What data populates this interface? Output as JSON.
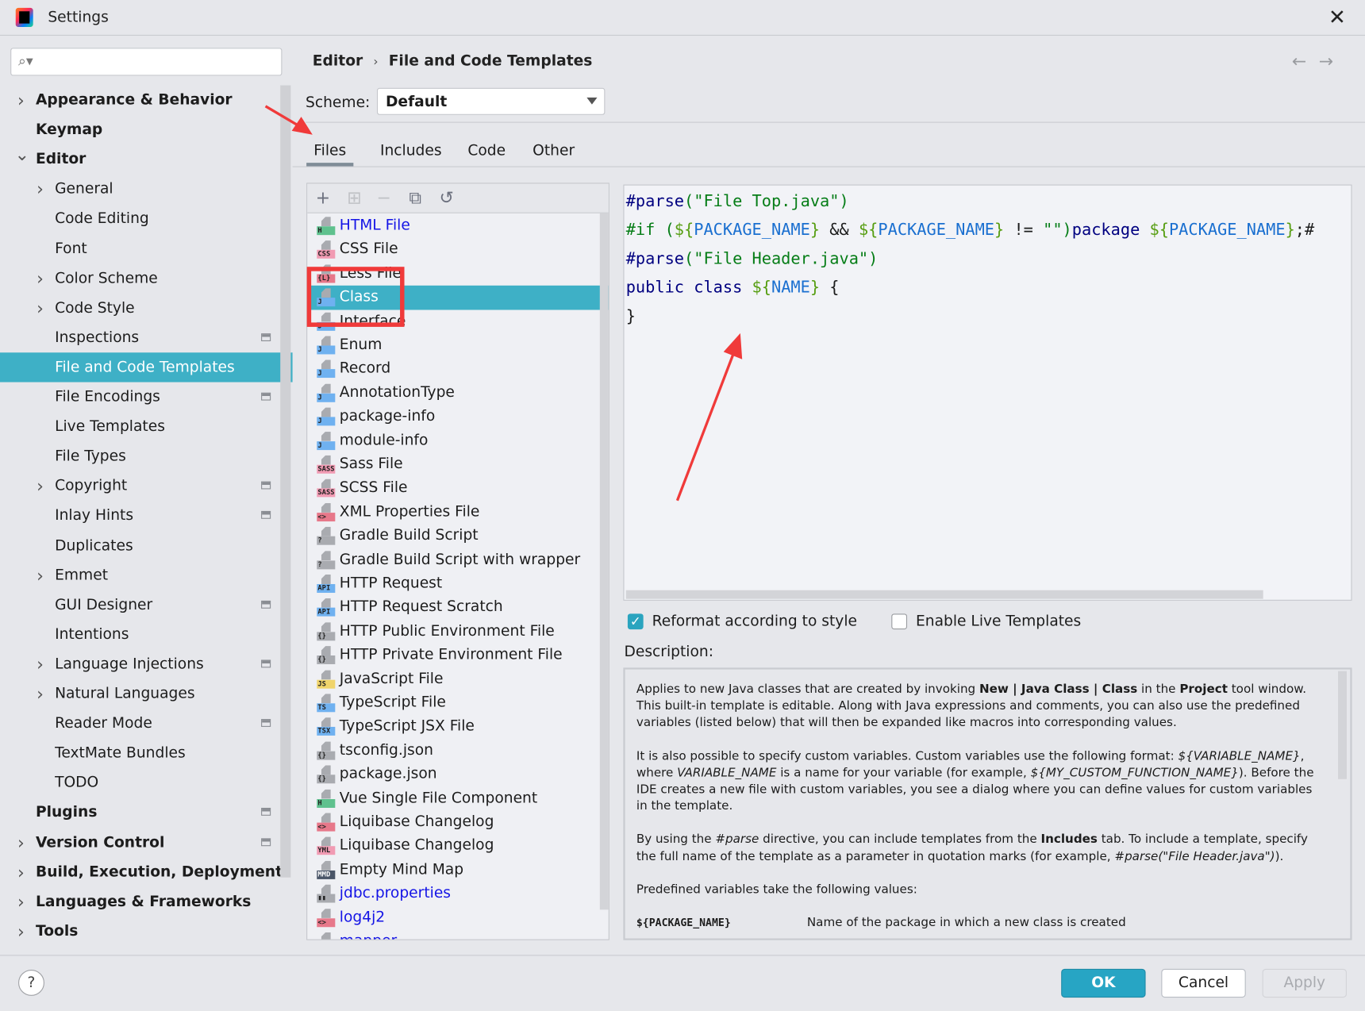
{
  "window": {
    "title": "Settings",
    "close_icon": "close-icon"
  },
  "search": {
    "placeholder": "",
    "icon": "search-icon"
  },
  "sidebar": {
    "selected": "File and Code Templates",
    "items": [
      {
        "label": "Appearance & Behavior",
        "level": 0,
        "bold": true,
        "arrow": "right",
        "project_icon": false
      },
      {
        "label": "Keymap",
        "level": 0,
        "bold": true,
        "arrow": "none",
        "project_icon": false
      },
      {
        "label": "Editor",
        "level": 0,
        "bold": true,
        "arrow": "down",
        "project_icon": false
      },
      {
        "label": "General",
        "level": 1,
        "bold": false,
        "arrow": "right",
        "project_icon": false
      },
      {
        "label": "Code Editing",
        "level": 1,
        "bold": false,
        "arrow": "none",
        "project_icon": false
      },
      {
        "label": "Font",
        "level": 1,
        "bold": false,
        "arrow": "none",
        "project_icon": false
      },
      {
        "label": "Color Scheme",
        "level": 1,
        "bold": false,
        "arrow": "right",
        "project_icon": false
      },
      {
        "label": "Code Style",
        "level": 1,
        "bold": false,
        "arrow": "right",
        "project_icon": false
      },
      {
        "label": "Inspections",
        "level": 1,
        "bold": false,
        "arrow": "none",
        "project_icon": true
      },
      {
        "label": "File and Code Templates",
        "level": 1,
        "bold": false,
        "arrow": "none",
        "project_icon": false,
        "selected": true
      },
      {
        "label": "File Encodings",
        "level": 1,
        "bold": false,
        "arrow": "none",
        "project_icon": true
      },
      {
        "label": "Live Templates",
        "level": 1,
        "bold": false,
        "arrow": "none",
        "project_icon": false
      },
      {
        "label": "File Types",
        "level": 1,
        "bold": false,
        "arrow": "none",
        "project_icon": false
      },
      {
        "label": "Copyright",
        "level": 1,
        "bold": false,
        "arrow": "right",
        "project_icon": true
      },
      {
        "label": "Inlay Hints",
        "level": 1,
        "bold": false,
        "arrow": "none",
        "project_icon": true
      },
      {
        "label": "Duplicates",
        "level": 1,
        "bold": false,
        "arrow": "none",
        "project_icon": false
      },
      {
        "label": "Emmet",
        "level": 1,
        "bold": false,
        "arrow": "right",
        "project_icon": false
      },
      {
        "label": "GUI Designer",
        "level": 1,
        "bold": false,
        "arrow": "none",
        "project_icon": true
      },
      {
        "label": "Intentions",
        "level": 1,
        "bold": false,
        "arrow": "none",
        "project_icon": false
      },
      {
        "label": "Language Injections",
        "level": 1,
        "bold": false,
        "arrow": "right",
        "project_icon": true
      },
      {
        "label": "Natural Languages",
        "level": 1,
        "bold": false,
        "arrow": "right",
        "project_icon": false
      },
      {
        "label": "Reader Mode",
        "level": 1,
        "bold": false,
        "arrow": "none",
        "project_icon": true
      },
      {
        "label": "TextMate Bundles",
        "level": 1,
        "bold": false,
        "arrow": "none",
        "project_icon": false
      },
      {
        "label": "TODO",
        "level": 1,
        "bold": false,
        "arrow": "none",
        "project_icon": false
      },
      {
        "label": "Plugins",
        "level": 0,
        "bold": true,
        "arrow": "none",
        "project_icon": true
      },
      {
        "label": "Version Control",
        "level": 0,
        "bold": true,
        "arrow": "right",
        "project_icon": true
      },
      {
        "label": "Build, Execution, Deployment",
        "level": 0,
        "bold": true,
        "arrow": "right",
        "project_icon": false
      },
      {
        "label": "Languages & Frameworks",
        "level": 0,
        "bold": true,
        "arrow": "right",
        "project_icon": false
      },
      {
        "label": "Tools",
        "level": 0,
        "bold": true,
        "arrow": "right",
        "project_icon": false
      }
    ]
  },
  "breadcrumb": {
    "parent": "Editor",
    "separator": "›",
    "current": "File and Code Templates"
  },
  "nav": {
    "back": "←",
    "forward": "→"
  },
  "scheme": {
    "label": "Scheme:",
    "value": "Default"
  },
  "tabs": [
    {
      "label": "Files",
      "active": true
    },
    {
      "label": "Includes"
    },
    {
      "label": "Code"
    },
    {
      "label": "Other"
    }
  ],
  "toolbar": {
    "add": "+",
    "add_child": "⊞",
    "remove": "−",
    "copy": "⧉",
    "reset": "↺"
  },
  "templates": {
    "selected": "Class",
    "items": [
      {
        "name": "HTML File",
        "badge": "H",
        "badge_color": "#5fc18e",
        "link": true
      },
      {
        "name": "CSS File",
        "badge": "CSS",
        "badge_color": "#f19bb3"
      },
      {
        "name": "Less File",
        "badge": "{L}",
        "badge_color": "#e7788a"
      },
      {
        "name": "Class",
        "badge": "J",
        "badge_color": "#6fb1f0",
        "selected": true
      },
      {
        "name": "Interface",
        "badge": "J",
        "badge_color": "#6fb1f0"
      },
      {
        "name": "Enum",
        "badge": "J",
        "badge_color": "#6fb1f0"
      },
      {
        "name": "Record",
        "badge": "J",
        "badge_color": "#6fb1f0"
      },
      {
        "name": "AnnotationType",
        "badge": "J",
        "badge_color": "#6fb1f0"
      },
      {
        "name": "package-info",
        "badge": "J",
        "badge_color": "#6fb1f0"
      },
      {
        "name": "module-info",
        "badge": "J",
        "badge_color": "#6fb1f0"
      },
      {
        "name": "Sass File",
        "badge": "SASS",
        "badge_color": "#f19bb3"
      },
      {
        "name": "SCSS File",
        "badge": "SASS",
        "badge_color": "#f19bb3"
      },
      {
        "name": "XML Properties File",
        "badge": "<>",
        "badge_color": "#e7788a"
      },
      {
        "name": "Gradle Build Script",
        "badge": "?",
        "badge_color": "#a9abb0"
      },
      {
        "name": "Gradle Build Script with wrapper",
        "badge": "?",
        "badge_color": "#a9abb0"
      },
      {
        "name": "HTTP Request",
        "badge": "API",
        "badge_color": "#6fb1f0"
      },
      {
        "name": "HTTP Request Scratch",
        "badge": "API",
        "badge_color": "#6fb1f0"
      },
      {
        "name": "HTTP Public Environment File",
        "badge": "{}",
        "badge_color": "#a9abb0"
      },
      {
        "name": "HTTP Private Environment File",
        "badge": "{}",
        "badge_color": "#a9abb0"
      },
      {
        "name": "JavaScript File",
        "badge": "JS",
        "badge_color": "#f0d46b"
      },
      {
        "name": "TypeScript File",
        "badge": "TS",
        "badge_color": "#6fb1f0"
      },
      {
        "name": "TypeScript JSX File",
        "badge": "TSX",
        "badge_color": "#6fb1f0"
      },
      {
        "name": "tsconfig.json",
        "badge": "{}",
        "badge_color": "#a9abb0"
      },
      {
        "name": "package.json",
        "badge": "{}",
        "badge_color": "#a9abb0"
      },
      {
        "name": "Vue Single File Component",
        "badge": "H",
        "badge_color": "#5fc18e"
      },
      {
        "name": "Liquibase Changelog",
        "badge": "<>",
        "badge_color": "#e7788a"
      },
      {
        "name": "Liquibase Changelog",
        "badge": "YML",
        "badge_color": "#f19bb3"
      },
      {
        "name": "Empty Mind Map",
        "badge": "MMD",
        "badge_color": "#4a5568"
      },
      {
        "name": "jdbc.properties",
        "badge": "▮▮",
        "badge_color": "#a9abb0",
        "link": true
      },
      {
        "name": "log4j2",
        "badge": "<>",
        "badge_color": "#e7788a",
        "link": true
      },
      {
        "name": "mapper",
        "badge": "",
        "badge_color": "#f19bb3",
        "link": true
      }
    ]
  },
  "editor": {
    "lines": [
      [
        [
          "#parse",
          "dir"
        ],
        [
          "(",
          "str"
        ],
        [
          "\"File Top.java\"",
          "str"
        ],
        [
          ")",
          "str"
        ]
      ],
      [
        [
          "#if",
          "str"
        ],
        [
          " (",
          "str"
        ],
        [
          "${",
          "dol"
        ],
        [
          "PACKAGE_NAME",
          "var"
        ],
        [
          "}",
          "dol"
        ],
        [
          " && ",
          "pl"
        ],
        [
          "${",
          "dol"
        ],
        [
          "PACKAGE_NAME",
          "var"
        ],
        [
          "}",
          "dol"
        ],
        [
          " != ",
          "pl"
        ],
        [
          "\"\"",
          "str"
        ],
        [
          ")",
          "str"
        ],
        [
          "package ",
          "kw"
        ],
        [
          "${",
          "dol"
        ],
        [
          "PACKAGE_NAME",
          "var"
        ],
        [
          "}",
          "dol"
        ],
        [
          ";#",
          "pl"
        ]
      ],
      [
        [
          "#parse",
          "dir"
        ],
        [
          "(",
          "str"
        ],
        [
          "\"File Header.java\"",
          "str"
        ],
        [
          ")",
          "str"
        ]
      ],
      [
        [
          "public class ",
          "kw"
        ],
        [
          "${",
          "dol"
        ],
        [
          "NAME",
          "var"
        ],
        [
          "}",
          "dol"
        ],
        [
          " {",
          "pl"
        ]
      ],
      [
        [
          "}",
          "pl"
        ]
      ]
    ]
  },
  "options": {
    "reformat": {
      "label": "Reformat according to style",
      "checked": true
    },
    "live_templates": {
      "label": "Enable Live Templates",
      "checked": false
    }
  },
  "description": {
    "label": "Description:",
    "p1": [
      [
        "Applies to new Java classes that are created by invoking ",
        ""
      ],
      [
        "New | Java Class | Class",
        "b"
      ],
      [
        " in the ",
        ""
      ],
      [
        "Project",
        "b"
      ],
      [
        " tool window. This built-in template is editable. Along with Java expressions and comments, you can also use the predefined variables (listed below) that will then be expanded like macros into corresponding values.",
        ""
      ]
    ],
    "p2": [
      [
        "It is also possible to specify custom variables. Custom variables use the following format: ",
        ""
      ],
      [
        "${VARIABLE_NAME}",
        "i"
      ],
      [
        ", where ",
        ""
      ],
      [
        "VARIABLE_NAME",
        "i"
      ],
      [
        " is a name for your variable (for example, ",
        ""
      ],
      [
        "${MY_CUSTOM_FUNCTION_NAME}",
        "i"
      ],
      [
        "). Before the IDE creates a new file with custom variables, you see a dialog where you can define values for custom variables in the template.",
        ""
      ]
    ],
    "p3": [
      [
        "By using the ",
        ""
      ],
      [
        "#parse",
        "i"
      ],
      [
        " directive, you can include templates from the ",
        ""
      ],
      [
        "Includes",
        "b"
      ],
      [
        " tab. To include a template, specify the full name of the template as a parameter in quotation marks (for example, ",
        ""
      ],
      [
        "#parse(\"File Header.java\")",
        "i"
      ],
      [
        ").",
        ""
      ]
    ],
    "p4": "Predefined variables take the following values:",
    "vars": [
      {
        "name": "${PACKAGE_NAME}",
        "desc": "Name of the package in which a new class is created"
      }
    ]
  },
  "footer": {
    "help": "?",
    "ok": "OK",
    "cancel": "Cancel",
    "apply": "Apply",
    "apply_enabled": false
  },
  "annotations": {
    "color": "#f03a3a"
  }
}
